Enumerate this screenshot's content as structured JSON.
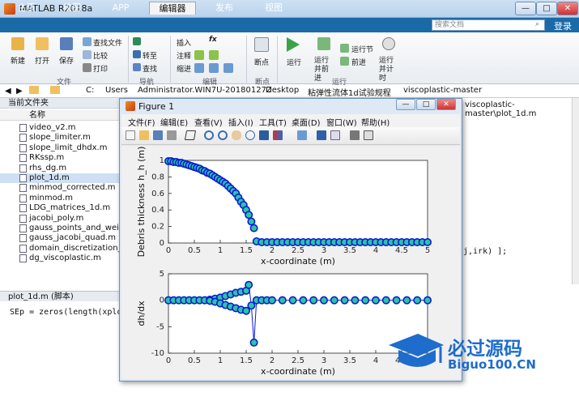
{
  "app_title": "MATLAB R2018a",
  "tabs": [
    "主页",
    "绘图",
    "APP",
    "编辑器",
    "发布",
    "视图"
  ],
  "active_tab": "编辑器",
  "search_placeholder": "搜索文档",
  "login_label": "登录",
  "ribbon": {
    "new": "新建",
    "open": "打开",
    "save": "保存",
    "find_files": "查找文件",
    "compare": "比较",
    "print": "打印",
    "insert": "插入",
    "fx": "fx",
    "goto": "转至",
    "find": "查找",
    "comment": "注释",
    "indent": "缩进",
    "breakpoints": "断点",
    "run": "运行",
    "run_advance": "运行并前进",
    "run_section": "运行节",
    "advance": "前进",
    "run_time": "运行并计时",
    "groups": [
      "文件",
      "导航",
      "编辑",
      "断点",
      "运行"
    ]
  },
  "address": [
    "C:",
    "Users",
    "Administrator.WIN7U-20180127Z",
    "Desktop",
    "粘弹性流体1d试验规程",
    "viscoplastic-master"
  ],
  "current_folder_label": "当前文件夹",
  "files_header": "名称",
  "files": [
    "video_v2.m",
    "slope_limiter.m",
    "slope_limit_dhdx.m",
    "RKssp.m",
    "rhs_dg.m",
    "plot_1d.m",
    "minmod_corrected.m",
    "minmod.m",
    "LDG_matrices_1d.m",
    "jacobi_poly.m",
    "gauss_points_and_weights",
    "gauss_jacobi_quad.m",
    "domain_discretization_1d.m",
    "dg_viscoplastic.m"
  ],
  "selected_file": "plot_1d.m",
  "detail_header": "plot_1d.m  (脚本)",
  "detail_code": "SEp = zeros(length(xplot),1);",
  "editor_path": "viscoplastic-master\\plot_1d.m",
  "editor_code": "j,irk) ];",
  "figure": {
    "title": "Figure 1",
    "menu": [
      "文件(F)",
      "编辑(E)",
      "查看(V)",
      "插入(I)",
      "工具(T)",
      "桌面(D)",
      "窗口(W)",
      "帮助(H)"
    ],
    "btn_min": "—",
    "btn_max": "□",
    "btn_close": "✕"
  },
  "chart_data": [
    {
      "type": "scatter",
      "ylabel": "Debris thickness h_h (m)",
      "xlabel": "x-coordinate (m)",
      "xlim": [
        0,
        5
      ],
      "ylim": [
        0,
        1
      ],
      "xticks": [
        0,
        0.5,
        1,
        1.5,
        2,
        2.5,
        3,
        3.5,
        4,
        4.5,
        5
      ],
      "yticks": [
        0,
        0.2,
        0.4,
        0.6,
        0.8,
        1
      ],
      "marker_fill": "#2ec4a0",
      "marker_edge": "#0a1adb",
      "series": [
        {
          "x": [
            0,
            0.05,
            0.1,
            0.15,
            0.2,
            0.25,
            0.3,
            0.35,
            0.4,
            0.45,
            0.5,
            0.55,
            0.6,
            0.65,
            0.7,
            0.75,
            0.8,
            0.85,
            0.9,
            0.95,
            1.0,
            1.05,
            1.1,
            1.15,
            1.2,
            1.25,
            1.3,
            1.35,
            1.4,
            1.45,
            1.5,
            1.55,
            1.6,
            1.65,
            1.7,
            1.8,
            1.9,
            2.0,
            2.1,
            2.2,
            2.3,
            2.4,
            2.5,
            2.6,
            2.7,
            2.8,
            2.9,
            3.0,
            3.1,
            3.2,
            3.3,
            3.4,
            3.5,
            3.6,
            3.7,
            3.8,
            3.9,
            4.0,
            4.1,
            4.2,
            4.3,
            4.4,
            4.5,
            4.6,
            4.7,
            4.8,
            4.9,
            5.0
          ],
          "y": [
            0.99,
            0.99,
            0.98,
            0.98,
            0.97,
            0.97,
            0.96,
            0.95,
            0.94,
            0.93,
            0.92,
            0.91,
            0.9,
            0.88,
            0.87,
            0.85,
            0.84,
            0.82,
            0.8,
            0.78,
            0.76,
            0.74,
            0.72,
            0.69,
            0.66,
            0.63,
            0.6,
            0.55,
            0.5,
            0.46,
            0.4,
            0.34,
            0.26,
            0.18,
            0.02,
            0.01,
            0.01,
            0.01,
            0.01,
            0.01,
            0.01,
            0.01,
            0.01,
            0.01,
            0.01,
            0.01,
            0.01,
            0.01,
            0.01,
            0.01,
            0.01,
            0.01,
            0.01,
            0.01,
            0.01,
            0.01,
            0.01,
            0.01,
            0.01,
            0.01,
            0.01,
            0.01,
            0.01,
            0.01,
            0.01,
            0.01,
            0.01,
            0.01
          ]
        }
      ]
    },
    {
      "type": "line",
      "ylabel": "dh/dx",
      "xlabel": "x-coordinate (m)",
      "xlim": [
        0,
        5
      ],
      "ylim": [
        -10,
        5
      ],
      "xticks": [
        0,
        0.5,
        1,
        1.5,
        2,
        2.5,
        3,
        3.5,
        4,
        4.5
      ],
      "yticks": [
        -10,
        -5,
        0,
        5
      ],
      "marker_fill": "#2ec4a0",
      "marker_edge": "#0a1adb",
      "series": [
        {
          "x": [
            0,
            0.1,
            0.2,
            0.3,
            0.4,
            0.5,
            0.6,
            0.7,
            0.8,
            0.9,
            1.0,
            1.1,
            1.2,
            1.3,
            1.4,
            1.5,
            1.55,
            1.6,
            1.65,
            1.7,
            1.8,
            1.9,
            2.0,
            2.2,
            2.4,
            2.6,
            2.8,
            3.0,
            3.2,
            3.4,
            3.6,
            3.8,
            4.0,
            4.2,
            4.4,
            4.6,
            4.8,
            5.0
          ],
          "y": [
            0,
            0,
            0,
            0,
            0,
            0,
            0,
            0,
            0.1,
            0.3,
            0.5,
            0.8,
            1.1,
            1.4,
            1.6,
            1.8,
            2.9,
            -1.0,
            -8.0,
            0,
            0,
            0,
            0,
            0,
            0,
            0,
            0,
            0,
            0,
            0,
            0,
            0,
            0,
            0,
            0,
            0,
            0,
            0
          ]
        },
        {
          "x": [
            0.8,
            0.9,
            1.0,
            1.1,
            1.2,
            1.3,
            1.4,
            1.5
          ],
          "y": [
            -0.1,
            -0.3,
            -0.6,
            -0.9,
            -1.2,
            -1.5,
            -1.8,
            -2.0
          ]
        }
      ]
    }
  ],
  "watermark": {
    "title": "必过源码",
    "url": "Biguo100.CN"
  }
}
